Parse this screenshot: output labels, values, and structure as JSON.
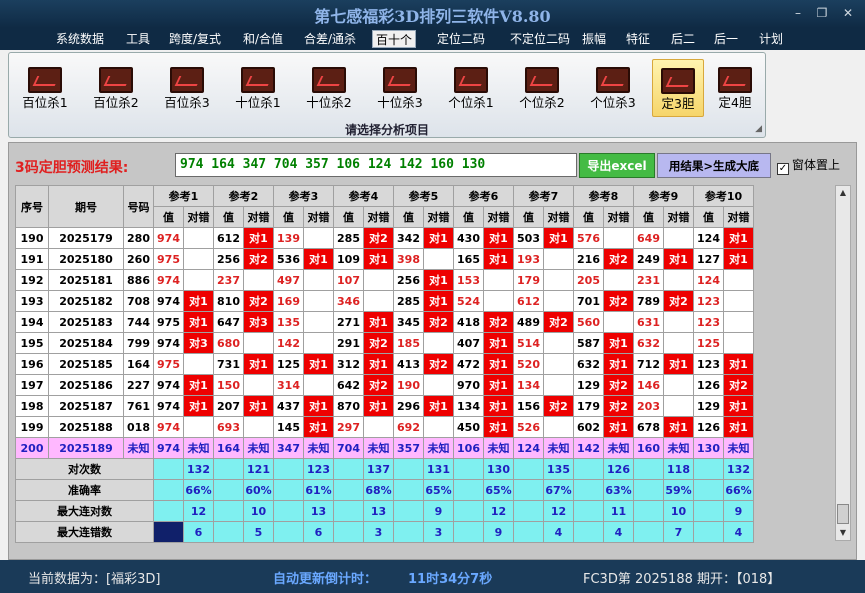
{
  "app_title": "第七感福彩3D排列三软件V8.80",
  "window_controls": {
    "minimize": "–",
    "restore": "❐",
    "close": "✕"
  },
  "menu": [
    "系统数据",
    "工具",
    "跨度/复式",
    "和/合值",
    "合差/通杀",
    "百十个",
    "定位二码",
    "不定位二码",
    "振幅",
    "特征",
    "后二",
    "后一",
    "计划"
  ],
  "menu_active": "百十个",
  "ribbon": {
    "buttons": [
      "百位杀1",
      "百位杀2",
      "百位杀3",
      "十位杀1",
      "十位杀2",
      "十位杀3",
      "个位杀1",
      "个位杀2",
      "个位杀3",
      "定3胆",
      "定4胆"
    ],
    "active": "定3胆",
    "caption": "请选择分析项目"
  },
  "result": {
    "label": "3码定胆预测结果:",
    "value": "974  164  347  704  357  106  124  142  160  130",
    "export_button": "导出excel",
    "generate_button": "用结果>生成大底",
    "on_top_label": "窗体置上",
    "on_top_checked": "✓"
  },
  "table": {
    "headers": {
      "seq": "序号",
      "period": "期号",
      "number": "号码",
      "refs": [
        "参考1",
        "参考2",
        "参考3",
        "参考4",
        "参考5",
        "参考6",
        "参考7",
        "参考8",
        "参考9",
        "参考10"
      ],
      "val": "值",
      "match": "对错"
    },
    "rows": [
      {
        "seq": "190",
        "period": "2025179",
        "num": "280",
        "cells": [
          [
            "974",
            "r",
            ""
          ],
          [
            "612",
            "",
            ""
          ],
          [
            "对1",
            "h",
            ""
          ],
          [
            "139",
            "r",
            ""
          ],
          [
            "285",
            "",
            ""
          ],
          [
            "对2",
            "h",
            ""
          ],
          [
            "342",
            "",
            ""
          ],
          [
            "对1",
            "h",
            ""
          ],
          [
            "430",
            "",
            ""
          ],
          [
            "对1",
            "h",
            ""
          ],
          [
            "503",
            "",
            ""
          ],
          [
            "对1",
            "h",
            ""
          ],
          [
            "576",
            "r",
            ""
          ],
          [
            "649",
            "r",
            ""
          ],
          [
            "124",
            "",
            ""
          ],
          [
            "对1",
            "h",
            ""
          ]
        ]
      },
      {
        "seq": "191",
        "period": "2025180",
        "num": "260",
        "cells": []
      },
      {
        "seq": "192",
        "period": "2025181",
        "num": "886",
        "cells": []
      },
      {
        "seq": "193",
        "period": "2025182",
        "num": "708",
        "cells": []
      },
      {
        "seq": "194",
        "period": "2025183",
        "num": "744",
        "cells": []
      },
      {
        "seq": "195",
        "period": "2025184",
        "num": "799",
        "cells": []
      },
      {
        "seq": "196",
        "period": "2025185",
        "num": "164",
        "cells": []
      },
      {
        "seq": "197",
        "period": "2025186",
        "num": "227",
        "cells": []
      },
      {
        "seq": "198",
        "period": "2025187",
        "num": "761",
        "cells": []
      },
      {
        "seq": "199",
        "period": "2025188",
        "num": "018",
        "cells": []
      },
      {
        "seq": "200",
        "period": "2025189",
        "num": "未知",
        "cells": []
      }
    ],
    "grid": [
      [
        [
          "974",
          "r"
        ],
        [
          "",
          ""
        ],
        [
          "612",
          ""
        ],
        [
          "对1",
          "h"
        ],
        [
          "139",
          "r"
        ],
        [
          "",
          ""
        ],
        [
          "285",
          ""
        ],
        [
          "对2",
          "h"
        ],
        [
          "342",
          ""
        ],
        [
          "对1",
          "h"
        ],
        [
          "430",
          ""
        ],
        [
          "对1",
          "h"
        ],
        [
          "503",
          ""
        ],
        [
          "对1",
          "h"
        ],
        [
          "576",
          "r"
        ],
        [
          "",
          ""
        ],
        [
          "649",
          "r"
        ],
        [
          "",
          ""
        ],
        [
          "124",
          ""
        ],
        [
          "对1",
          "h"
        ]
      ],
      [
        [
          "975",
          "r"
        ],
        [
          "",
          ""
        ],
        [
          "256",
          ""
        ],
        [
          "对2",
          "h"
        ],
        [
          "536",
          ""
        ],
        [
          "对1",
          "h"
        ],
        [
          "109",
          ""
        ],
        [
          "对1",
          "h"
        ],
        [
          "398",
          "r"
        ],
        [
          "",
          ""
        ],
        [
          "165",
          ""
        ],
        [
          "对1",
          "h"
        ],
        [
          "193",
          "r"
        ],
        [
          "",
          ""
        ],
        [
          "216",
          ""
        ],
        [
          "对2",
          "h"
        ],
        [
          "249",
          ""
        ],
        [
          "对1",
          "h"
        ],
        [
          "127",
          ""
        ],
        [
          "对1",
          "h"
        ]
      ],
      [
        [
          "974",
          "r"
        ],
        [
          "",
          ""
        ],
        [
          "237",
          "r"
        ],
        [
          "",
          ""
        ],
        [
          "497",
          "r"
        ],
        [
          "",
          ""
        ],
        [
          "107",
          "r"
        ],
        [
          "",
          ""
        ],
        [
          "256",
          ""
        ],
        [
          "对1",
          "h"
        ],
        [
          "153",
          "r"
        ],
        [
          "",
          ""
        ],
        [
          "179",
          "r"
        ],
        [
          "",
          ""
        ],
        [
          "205",
          "r"
        ],
        [
          "",
          ""
        ],
        [
          "231",
          "r"
        ],
        [
          "",
          ""
        ],
        [
          "124",
          "r"
        ],
        [
          "",
          ""
        ]
      ],
      [
        [
          "974",
          ""
        ],
        [
          "对1",
          "h"
        ],
        [
          "810",
          ""
        ],
        [
          "对2",
          "h"
        ],
        [
          "169",
          "r"
        ],
        [
          "",
          ""
        ],
        [
          "346",
          "r"
        ],
        [
          "",
          ""
        ],
        [
          "285",
          ""
        ],
        [
          "对1",
          "h"
        ],
        [
          "524",
          "r"
        ],
        [
          "",
          ""
        ],
        [
          "612",
          "r"
        ],
        [
          "",
          ""
        ],
        [
          "701",
          ""
        ],
        [
          "对2",
          "h"
        ],
        [
          "789",
          ""
        ],
        [
          "对2",
          "h"
        ],
        [
          "123",
          "r"
        ],
        [
          "",
          ""
        ]
      ],
      [
        [
          "975",
          ""
        ],
        [
          "对1",
          "h"
        ],
        [
          "647",
          ""
        ],
        [
          "对3",
          "h"
        ],
        [
          "135",
          "r"
        ],
        [
          "",
          ""
        ],
        [
          "271",
          ""
        ],
        [
          "对1",
          "h"
        ],
        [
          "345",
          ""
        ],
        [
          "对2",
          "h"
        ],
        [
          "418",
          ""
        ],
        [
          "对2",
          "h"
        ],
        [
          "489",
          ""
        ],
        [
          "对2",
          "h"
        ],
        [
          "560",
          "r"
        ],
        [
          "",
          ""
        ],
        [
          "631",
          "r"
        ],
        [
          "",
          ""
        ],
        [
          "123",
          "r"
        ],
        [
          "",
          ""
        ]
      ],
      [
        [
          "974",
          ""
        ],
        [
          "对3",
          "h"
        ],
        [
          "680",
          "r"
        ],
        [
          "",
          ""
        ],
        [
          "142",
          "r"
        ],
        [
          "",
          ""
        ],
        [
          "291",
          ""
        ],
        [
          "对2",
          "h"
        ],
        [
          "185",
          "r"
        ],
        [
          "",
          ""
        ],
        [
          "407",
          ""
        ],
        [
          "对1",
          "h"
        ],
        [
          "514",
          "r"
        ],
        [
          "",
          ""
        ],
        [
          "587",
          ""
        ],
        [
          "对1",
          "h"
        ],
        [
          "632",
          "r"
        ],
        [
          "",
          ""
        ],
        [
          "125",
          "r"
        ],
        [
          "",
          ""
        ]
      ],
      [
        [
          "975",
          "r"
        ],
        [
          "",
          ""
        ],
        [
          "731",
          ""
        ],
        [
          "对1",
          "h"
        ],
        [
          "125",
          ""
        ],
        [
          "对1",
          "h"
        ],
        [
          "312",
          ""
        ],
        [
          "对1",
          "h"
        ],
        [
          "413",
          ""
        ],
        [
          "对2",
          "h"
        ],
        [
          "472",
          ""
        ],
        [
          "对1",
          "h"
        ],
        [
          "520",
          "r"
        ],
        [
          "",
          ""
        ],
        [
          "632",
          ""
        ],
        [
          "对1",
          "h"
        ],
        [
          "712",
          ""
        ],
        [
          "对1",
          "h"
        ],
        [
          "123",
          ""
        ],
        [
          "对1",
          "h"
        ]
      ],
      [
        [
          "974",
          ""
        ],
        [
          "对1",
          "h"
        ],
        [
          "150",
          "r"
        ],
        [
          "",
          ""
        ],
        [
          "314",
          "r"
        ],
        [
          "",
          ""
        ],
        [
          "642",
          ""
        ],
        [
          "对2",
          "h"
        ],
        [
          "190",
          "r"
        ],
        [
          "",
          ""
        ],
        [
          "970",
          ""
        ],
        [
          "对1",
          "h"
        ],
        [
          "134",
          "r"
        ],
        [
          "",
          ""
        ],
        [
          "129",
          ""
        ],
        [
          "对2",
          "h"
        ],
        [
          "146",
          "r"
        ],
        [
          "",
          ""
        ],
        [
          "126",
          ""
        ],
        [
          "对2",
          "h"
        ]
      ],
      [
        [
          "974",
          ""
        ],
        [
          "对1",
          "h"
        ],
        [
          "207",
          ""
        ],
        [
          "对1",
          "h"
        ],
        [
          "437",
          ""
        ],
        [
          "对1",
          "h"
        ],
        [
          "870",
          ""
        ],
        [
          "对1",
          "h"
        ],
        [
          "296",
          ""
        ],
        [
          "对1",
          "h"
        ],
        [
          "134",
          ""
        ],
        [
          "对1",
          "h"
        ],
        [
          "156",
          ""
        ],
        [
          "对2",
          "h"
        ],
        [
          "179",
          ""
        ],
        [
          "对2",
          "h"
        ],
        [
          "203",
          "r"
        ],
        [
          "",
          ""
        ],
        [
          "129",
          ""
        ],
        [
          "对1",
          "h"
        ]
      ],
      [
        [
          "974",
          "r"
        ],
        [
          "",
          ""
        ],
        [
          "693",
          "r"
        ],
        [
          "",
          ""
        ],
        [
          "145",
          ""
        ],
        [
          "对1",
          "h"
        ],
        [
          "297",
          "r"
        ],
        [
          "",
          ""
        ],
        [
          "692",
          "r"
        ],
        [
          "",
          ""
        ],
        [
          "450",
          ""
        ],
        [
          "对1",
          "h"
        ],
        [
          "526",
          "r"
        ],
        [
          "",
          ""
        ],
        [
          "602",
          ""
        ],
        [
          "对1",
          "h"
        ],
        [
          "678",
          ""
        ],
        [
          "对1",
          "h"
        ],
        [
          "126",
          ""
        ],
        [
          "对1",
          "h"
        ]
      ],
      [
        [
          "974",
          ""
        ],
        [
          "未知",
          ""
        ],
        [
          "164",
          ""
        ],
        [
          "未知",
          ""
        ],
        [
          "347",
          ""
        ],
        [
          "未知",
          ""
        ],
        [
          "704",
          ""
        ],
        [
          "未知",
          ""
        ],
        [
          "357",
          ""
        ],
        [
          "未知",
          ""
        ],
        [
          "106",
          ""
        ],
        [
          "未知",
          ""
        ],
        [
          "124",
          ""
        ],
        [
          "未知",
          ""
        ],
        [
          "142",
          ""
        ],
        [
          "未知",
          ""
        ],
        [
          "160",
          ""
        ],
        [
          "未知",
          ""
        ],
        [
          "130",
          ""
        ],
        [
          "未知",
          ""
        ]
      ]
    ],
    "stats": [
      {
        "label": "对次数",
        "values": [
          "132",
          "121",
          "123",
          "137",
          "131",
          "130",
          "135",
          "126",
          "118",
          "132"
        ]
      },
      {
        "label": "准确率",
        "values": [
          "66%",
          "60%",
          "61%",
          "68%",
          "65%",
          "65%",
          "67%",
          "63%",
          "59%",
          "66%"
        ]
      },
      {
        "label": "最大连对数",
        "values": [
          "12",
          "10",
          "13",
          "13",
          "9",
          "12",
          "12",
          "11",
          "10",
          "9"
        ]
      },
      {
        "label": "最大连错数",
        "values": [
          "6",
          "5",
          "6",
          "3",
          "3",
          "9",
          "4",
          "4",
          "7",
          "4"
        ]
      }
    ]
  },
  "status": {
    "current_data": "当前数据为：[福彩3D]",
    "countdown_label": "自动更新倒计时：",
    "countdown_value": "11时34分7秒",
    "issue_info": "FC3D第 2025188 期开：【018】"
  }
}
